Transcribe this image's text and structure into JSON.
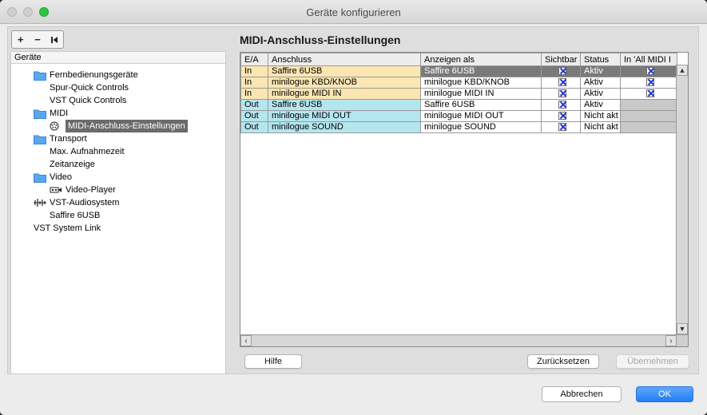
{
  "window": {
    "title": "Geräte konfigurieren"
  },
  "toolbar": {
    "add": "+",
    "remove": "−"
  },
  "tree": {
    "header": "Geräte",
    "items": [
      {
        "label": "Fernbedienungsgeräte",
        "icon": "folder-icon"
      },
      {
        "label": "Spur-Quick Controls"
      },
      {
        "label": "VST Quick Controls"
      },
      {
        "label": "MIDI",
        "icon": "folder-icon"
      },
      {
        "label": "MIDI-Anschluss-Einstellungen",
        "icon": "midi-port-icon",
        "selected": true
      },
      {
        "label": "Transport",
        "icon": "folder-icon"
      },
      {
        "label": "Max. Aufnahmezeit"
      },
      {
        "label": "Zeitanzeige"
      },
      {
        "label": "Video",
        "icon": "folder-icon"
      },
      {
        "label": "Video-Player",
        "icon": "video-icon"
      },
      {
        "label": "VST-Audiosystem",
        "icon": "audio-system-icon"
      },
      {
        "label": "Saffire 6USB"
      },
      {
        "label": "VST System Link"
      }
    ]
  },
  "main": {
    "title": "MIDI-Anschluss-Einstellungen",
    "columns": [
      "E/A",
      "Anschluss",
      "Anzeigen als",
      "Sichtbar",
      "Status",
      "In 'All MIDI I"
    ],
    "rows": [
      {
        "io": "In",
        "port": "Saffire 6USB",
        "display": "Saffire 6USB",
        "visible": true,
        "status": "Aktiv",
        "all_midi": true
      },
      {
        "io": "In",
        "port": "minilogue KBD/KNOB",
        "display": "minilogue KBD/KNOB",
        "visible": true,
        "status": "Aktiv",
        "all_midi": true
      },
      {
        "io": "In",
        "port": "minilogue MIDI IN",
        "display": "minilogue MIDI IN",
        "visible": true,
        "status": "Aktiv",
        "all_midi": true
      },
      {
        "io": "Out",
        "port": "Saffire 6USB",
        "display": "Saffire 6USB",
        "visible": true,
        "status": "Aktiv",
        "all_midi": null
      },
      {
        "io": "Out",
        "port": "minilogue MIDI OUT",
        "display": "minilogue MIDI OUT",
        "visible": true,
        "status": "Nicht akt",
        "all_midi": null
      },
      {
        "io": "Out",
        "port": "minilogue SOUND",
        "display": "minilogue SOUND",
        "visible": true,
        "status": "Nicht akt",
        "all_midi": null
      }
    ],
    "selected_row": 0,
    "buttons": {
      "help": "Hilfe",
      "reset": "Zurücksetzen",
      "apply": "Übernehmen"
    }
  },
  "dialog": {
    "cancel": "Abbrechen",
    "ok": "OK"
  },
  "colors": {
    "input_row": "#fbe6b2",
    "output_row": "#b4e6f0",
    "accent": "#1f7ef5",
    "selection": "#6b6b6b"
  }
}
